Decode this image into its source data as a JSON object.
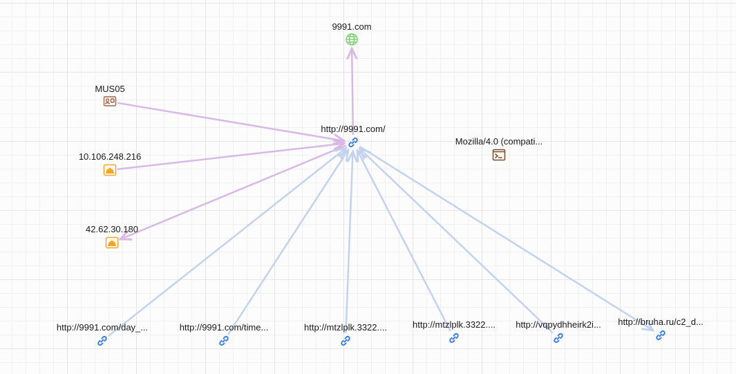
{
  "graph": {
    "nodes": [
      {
        "id": "domain",
        "name": "node-domain-9991",
        "label": "9991.com",
        "icon": "globe-icon",
        "color": "#7ccf6e"
      },
      {
        "id": "user",
        "name": "node-user-mus05",
        "label": "MUS05",
        "icon": "user-card-icon",
        "color": "#a0654a"
      },
      {
        "id": "ip1",
        "name": "node-ip-10-106-248-216",
        "label": "10.106.248.216",
        "icon": "host-icon",
        "color": "#f5a623"
      },
      {
        "id": "ip2",
        "name": "node-ip-42-62-30-180",
        "label": "42.62.30.180",
        "icon": "host-icon",
        "color": "#f5a623"
      },
      {
        "id": "url_main",
        "name": "node-url-main",
        "label": "http://9991.com/",
        "icon": "link-icon",
        "color": "#3d7fe0"
      },
      {
        "id": "ua",
        "name": "node-user-agent",
        "label": "Mozilla/4.0 (compati...",
        "icon": "terminal-icon",
        "color": "#7a4a2a"
      },
      {
        "id": "u1",
        "name": "node-url-1",
        "label": "http://9991.com/day_...",
        "icon": "link-icon",
        "color": "#3d7fe0"
      },
      {
        "id": "u2",
        "name": "node-url-2",
        "label": "http://9991.com/time...",
        "icon": "link-icon",
        "color": "#3d7fe0"
      },
      {
        "id": "u3",
        "name": "node-url-3",
        "label": "http://mtzlplk.3322....",
        "icon": "link-icon",
        "color": "#3d7fe0"
      },
      {
        "id": "u4",
        "name": "node-url-4",
        "label": "http://mtzlplk.3322....",
        "icon": "link-icon",
        "color": "#3d7fe0"
      },
      {
        "id": "u5",
        "name": "node-url-5",
        "label": "http://vqpydhheirk2i...",
        "icon": "link-icon",
        "color": "#3d7fe0"
      },
      {
        "id": "u6",
        "name": "node-url-6",
        "label": "http://bruha.ru/c2_d...",
        "icon": "link-icon",
        "color": "#3d7fe0"
      }
    ],
    "edges": [
      {
        "from": "url_main",
        "to": "domain",
        "color": "#d9b8e6"
      },
      {
        "from": "user",
        "to": "url_main",
        "color": "#d9b8e6"
      },
      {
        "from": "ip1",
        "to": "url_main",
        "color": "#d9b8e6"
      },
      {
        "from": "url_main",
        "to": "ip2",
        "color": "#d9b8e6"
      },
      {
        "from": "u1",
        "to": "url_main",
        "color": "#c3d2ee"
      },
      {
        "from": "u2",
        "to": "url_main",
        "color": "#c3d2ee"
      },
      {
        "from": "u3",
        "to": "url_main",
        "color": "#c3d2ee"
      },
      {
        "from": "u4",
        "to": "url_main",
        "color": "#c3d2ee"
      },
      {
        "from": "u5",
        "to": "url_main",
        "color": "#c3d2ee"
      },
      {
        "from": "url_main",
        "to": "u6",
        "color": "#c3d2ee"
      }
    ]
  }
}
